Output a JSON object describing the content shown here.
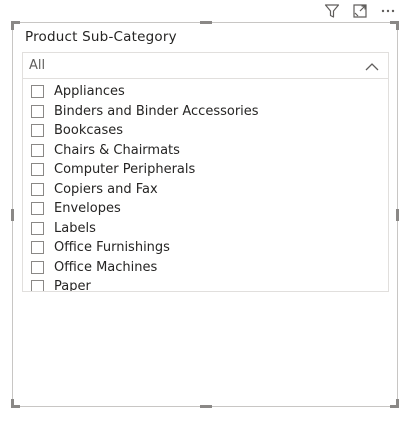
{
  "toolbar": {
    "icons": [
      "filter-icon",
      "focus-mode-icon",
      "more-options-icon"
    ]
  },
  "slicer": {
    "title": "Product Sub-Category",
    "dropdown": {
      "selected": "All"
    },
    "items": [
      {
        "label": "Appliances",
        "checked": false
      },
      {
        "label": "Binders and Binder Accessories",
        "checked": false
      },
      {
        "label": "Bookcases",
        "checked": false
      },
      {
        "label": "Chairs & Chairmats",
        "checked": false
      },
      {
        "label": "Computer Peripherals",
        "checked": false
      },
      {
        "label": "Copiers and Fax",
        "checked": false
      },
      {
        "label": "Envelopes",
        "checked": false
      },
      {
        "label": "Labels",
        "checked": false
      },
      {
        "label": "Office Furnishings",
        "checked": false
      },
      {
        "label": "Office Machines",
        "checked": false
      },
      {
        "label": "Paper",
        "checked": false
      }
    ]
  },
  "colors": {
    "border": "#c8c6c4",
    "text": "#252423",
    "muted": "#605e5c",
    "handle": "#8a8886"
  }
}
